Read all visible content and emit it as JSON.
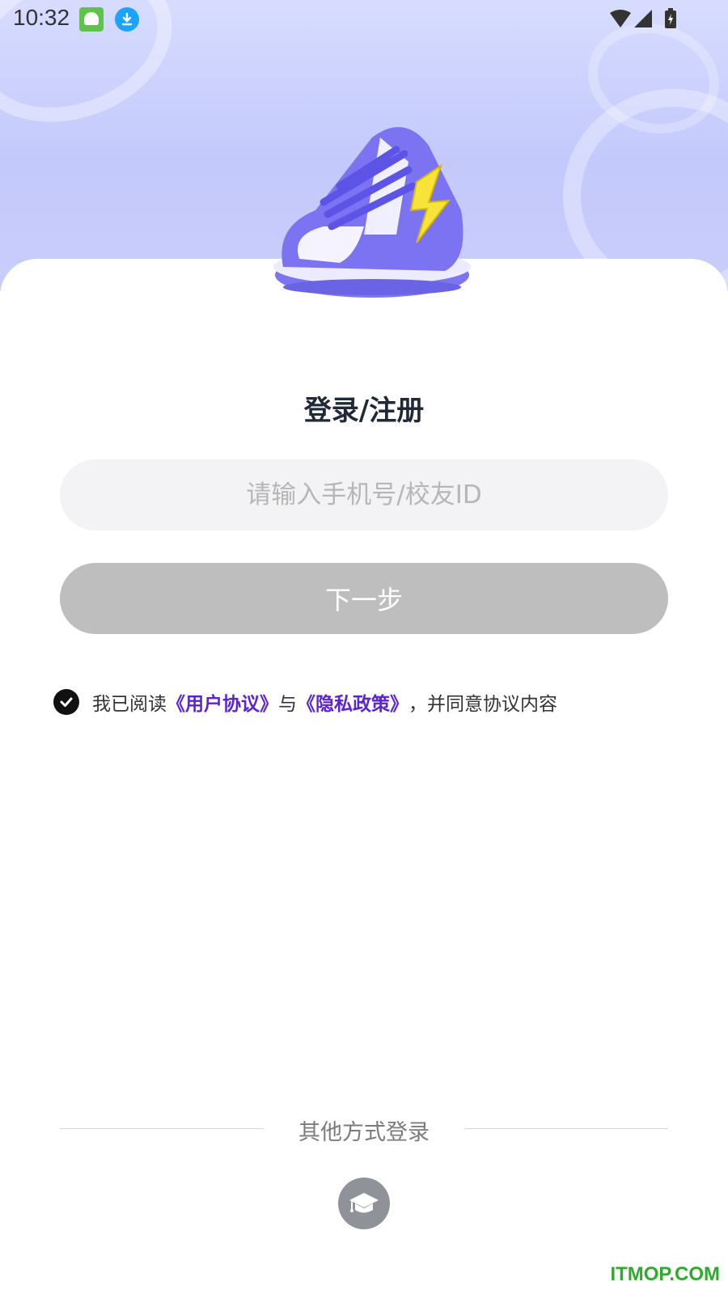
{
  "status_bar": {
    "time": "10:32",
    "icons": [
      "app-notification-icon",
      "download-icon",
      "wifi-icon",
      "cell-signal-icon",
      "battery-charging-icon"
    ]
  },
  "hero": {
    "illustration": "sneaker-illustration"
  },
  "login": {
    "title": "登录/注册",
    "phone_placeholder": "请输入手机号/校友ID",
    "phone_value": "",
    "next_label": "下一步"
  },
  "agreement": {
    "checked": true,
    "prefix": "我已阅读",
    "user_agreement": "《用户协议》",
    "conjunction": "与",
    "privacy_policy": "《隐私政策》",
    "suffix": "，并同意协议内容"
  },
  "other_login": {
    "label": "其他方式登录",
    "method_icon": "graduation-cap-icon"
  },
  "watermark": "ITMOP.COM",
  "colors": {
    "hero_bg": "#c9cdfb",
    "link": "#5b22d6",
    "button_disabled": "#bebebe",
    "input_bg": "#f3f3f5"
  }
}
